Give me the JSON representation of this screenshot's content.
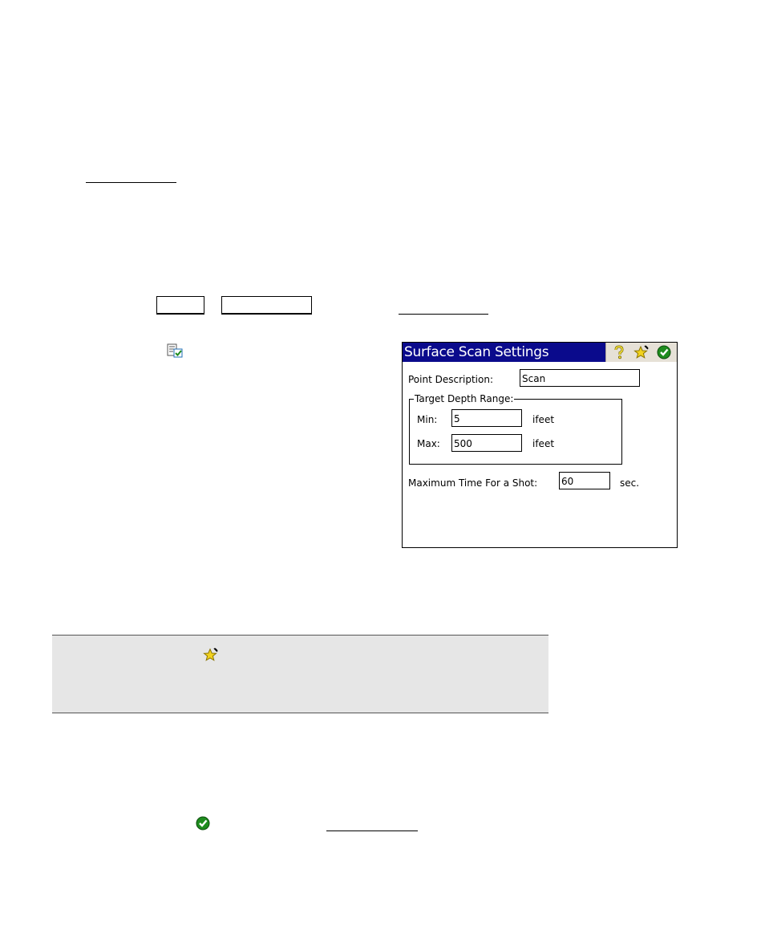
{
  "dialog": {
    "title": "Surface Scan Settings",
    "point_description": {
      "label": "Point Description:",
      "value": "Scan"
    },
    "target_depth_range": {
      "legend": "Target Depth Range:",
      "min": {
        "label": "Min:",
        "value": "5",
        "unit": "ifeet"
      },
      "max": {
        "label": "Max:",
        "value": "500",
        "unit": "ifeet"
      }
    },
    "max_time": {
      "label": "Maximum Time For a Shot:",
      "value": "60",
      "unit": "sec."
    }
  },
  "icons": {
    "help": "help-icon",
    "favorites": "favorites-star-icon",
    "accept": "accept-check-icon",
    "settings_list": "settings-list-icon"
  },
  "colors": {
    "titlebar": "#0a0a8c",
    "note_background": "#e6e6e6",
    "accept_green": "#1e8c1e",
    "star_yellow": "#f2d21e"
  }
}
